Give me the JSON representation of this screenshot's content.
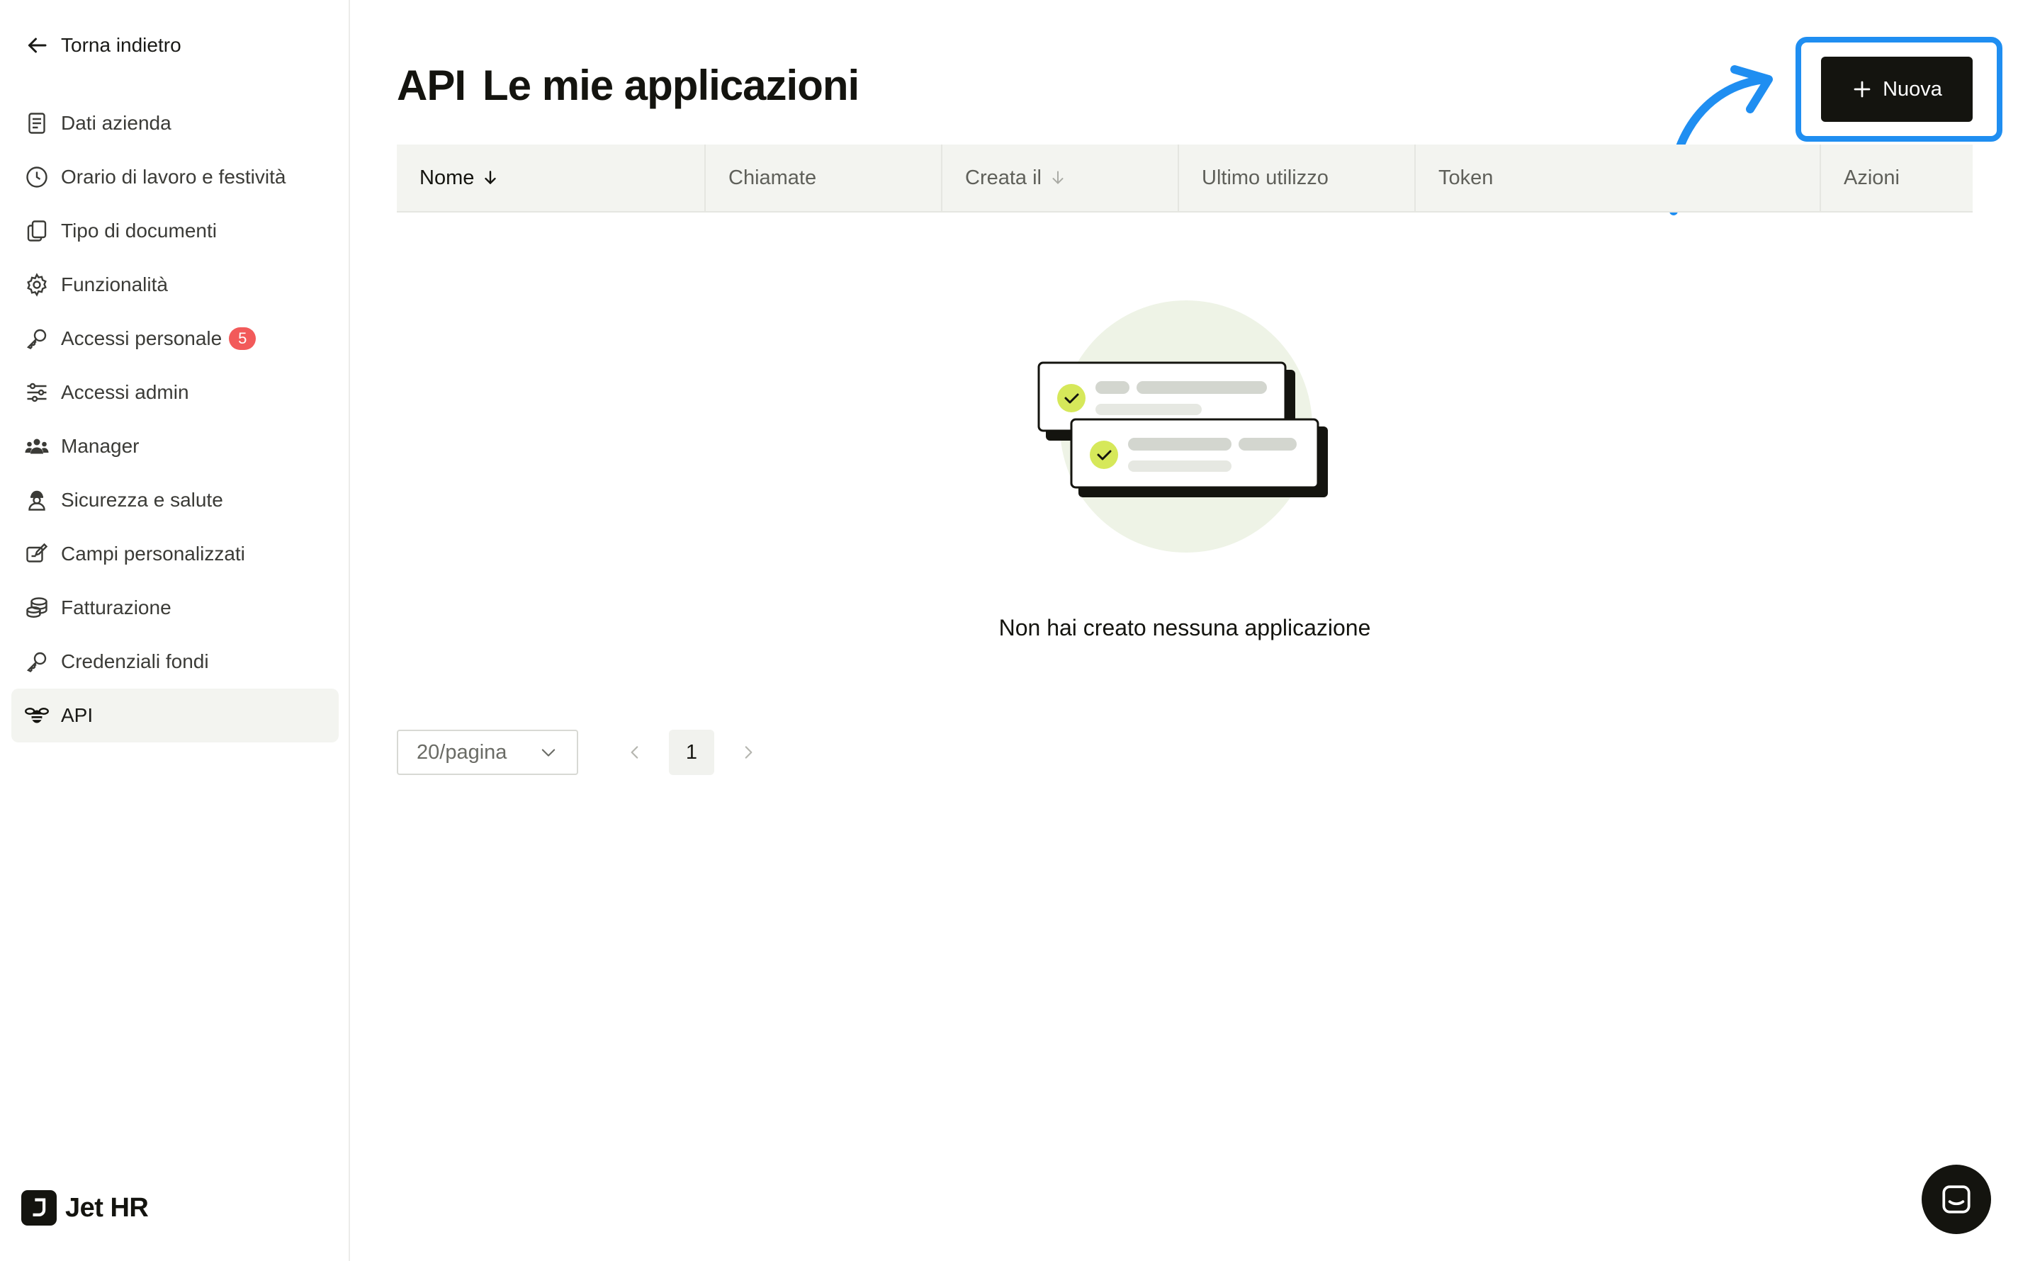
{
  "sidebar": {
    "back_label": "Torna indietro",
    "items": [
      {
        "label": "Dati azienda",
        "icon": "document-icon"
      },
      {
        "label": "Orario di lavoro e festività",
        "icon": "clock-icon"
      },
      {
        "label": "Tipo di documenti",
        "icon": "copy-icon"
      },
      {
        "label": "Funzionalità",
        "icon": "gear-icon"
      },
      {
        "label": "Accessi personale",
        "icon": "key-icon",
        "badge": "5"
      },
      {
        "label": "Accessi admin",
        "icon": "sliders-icon"
      },
      {
        "label": "Manager",
        "icon": "people-icon"
      },
      {
        "label": "Sicurezza e salute",
        "icon": "worker-icon"
      },
      {
        "label": "Campi personalizzati",
        "icon": "edit-card-icon"
      },
      {
        "label": "Fatturazione",
        "icon": "coins-icon"
      },
      {
        "label": "Credenziali fondi",
        "icon": "key-icon"
      },
      {
        "label": "API",
        "icon": "bee-icon",
        "active": true
      }
    ],
    "logo_text": "Jet HR"
  },
  "header": {
    "title_strong": "API",
    "title_rest": "Le mie applicazioni",
    "new_button_label": "Nuova"
  },
  "table": {
    "columns": [
      "Nome",
      "Chiamate",
      "Creata il",
      "Ultimo utilizzo",
      "Token",
      "Azioni"
    ],
    "empty_message": "Non hai creato nessuna applicazione"
  },
  "pagination": {
    "page_size": "20/pagina",
    "current_page": "1"
  },
  "colors": {
    "accent_highlight": "#1f8ef1",
    "button_dark": "#14140f",
    "badge": "#f25a5a",
    "check_green": "#d6e85a"
  }
}
